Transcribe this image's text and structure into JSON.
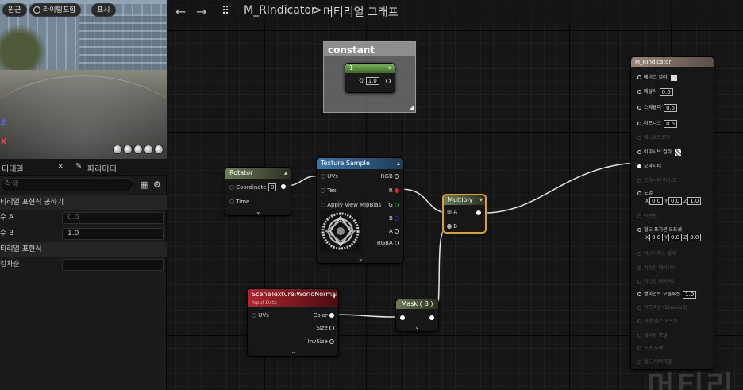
{
  "viewport": {
    "buttons": [
      "원근",
      "라이팅포함",
      "표시"
    ],
    "axes": [
      "Z",
      "X"
    ]
  },
  "details": {
    "tab_details": "디테일",
    "tab_close": "×",
    "tab_params": "파라미터",
    "search_placeholder": "검색",
    "section_shared": "티리얼 표현식 공하기",
    "prop_a_label": "수 A",
    "prop_a_value": "0.0",
    "prop_b_label": "수 B",
    "prop_b_value": "1.0",
    "section_expr": "티리얼 표현식",
    "prop_desc_label": "킹차순"
  },
  "graph": {
    "breadcrumb_asset": "M_RIndicator",
    "breadcrumb_sep": ">",
    "breadcrumb_view": "머티리얼 그래프",
    "watermark": "머티리"
  },
  "nodes": {
    "constant": {
      "title": "constant",
      "header": "1",
      "pin_label": "값",
      "value": "1.0"
    },
    "rotator": {
      "title": "Rotator",
      "pins": [
        "Coordinate",
        "Time"
      ],
      "coord_value": "0"
    },
    "texture_sample": {
      "title": "Texture Sample",
      "inputs": [
        "UVs",
        "Tex",
        "Apply View MipBias"
      ],
      "outputs": [
        "RGB",
        "R",
        "G",
        "B",
        "A",
        "RGBA"
      ]
    },
    "multiply": {
      "title": "Multiply",
      "inputs": [
        "A",
        "B"
      ]
    },
    "scene_texture": {
      "title": "SceneTexture:WorldNormal",
      "subtitle": "Input Data",
      "inputs": [
        "UVs"
      ],
      "outputs": [
        "Color",
        "Size",
        "InvSize"
      ]
    },
    "mask": {
      "title": "Mask ( B )"
    }
  },
  "result_node": {
    "title": "M_RIndicator",
    "rows": [
      {
        "label": "베이스 컬러",
        "active": true
      },
      {
        "label": "메탈릭",
        "active": true,
        "value": "0.0"
      },
      {
        "label": "스페큘러",
        "active": true,
        "value": "0.5"
      },
      {
        "label": "러프니스",
        "active": true,
        "value": "0.5"
      },
      {
        "label": "애니소트로피",
        "active": false
      },
      {
        "label": "이미시브 컬러",
        "active": true
      },
      {
        "label": "오파시티",
        "active": true
      },
      {
        "label": "오파시티 마스크",
        "active": false
      },
      {
        "label": "노멀",
        "active": true,
        "x": "0.0",
        "y": "0.0",
        "z": "1.0"
      },
      {
        "label": "탄젠트",
        "active": false
      },
      {
        "label": "월드 포지션 오프셋",
        "active": true,
        "x": "0.0",
        "y": "0.0",
        "z": "0.0"
      },
      {
        "label": "서브서피스 컬러",
        "active": false
      },
      {
        "label": "커스텀 데이터0",
        "active": false
      },
      {
        "label": "커스텀 데이터1",
        "active": false
      },
      {
        "label": "앰비언트 오클루전",
        "active": true,
        "value": "1.0"
      },
      {
        "label": "리프랙션 (Disabled)",
        "active": false
      },
      {
        "label": "픽셀 뎁스 오프셋",
        "active": false
      },
      {
        "label": "셰이딩 모델",
        "active": false
      },
      {
        "label": "표면 두께",
        "active": false
      },
      {
        "label": "월드 머티리얼",
        "active": false
      }
    ]
  },
  "colors": {
    "rotator_header": "#5a6b48",
    "texture_header": "#2f5d86",
    "multiply_border": "#e0a020",
    "scene_header": "#9b1a22",
    "result_header": "#8c7a6e"
  }
}
